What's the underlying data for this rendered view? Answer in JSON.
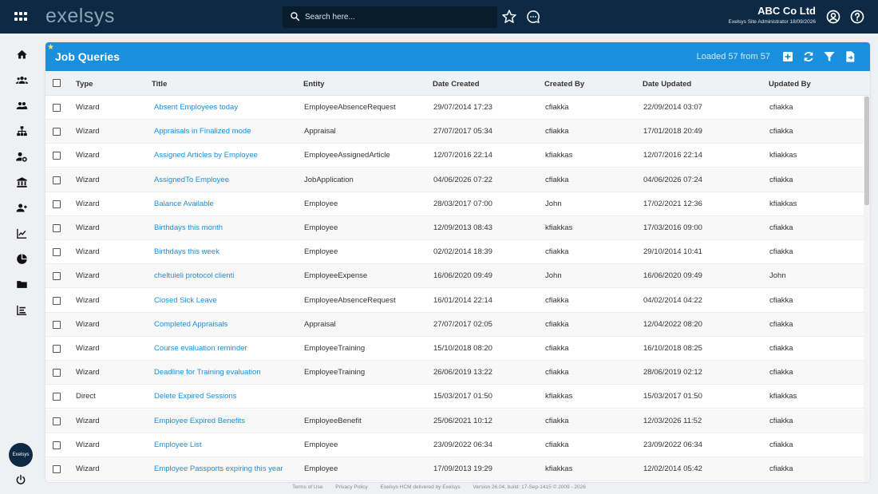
{
  "header": {
    "logo_text": "exelsys",
    "search_placeholder": "Search here...",
    "company_name": "ABC Co Ltd",
    "user_role": "Exelsys Site Administrator 18/09/2026"
  },
  "sidebar": {
    "items": [
      "home-icon",
      "employees-icon",
      "groups-icon",
      "org-chart-icon",
      "user-settings-icon",
      "bank-icon",
      "add-user-icon",
      "trend-chart-icon",
      "pie-chart-icon",
      "folder-icon",
      "list-icon"
    ],
    "avatar_text": "Exelsys"
  },
  "panel": {
    "title": "Job Queries",
    "loaded_text": "Loaded 57 from 57",
    "accent_color": "#1a8fdc"
  },
  "table": {
    "columns": [
      "Type",
      "Title",
      "Entity",
      "Date Created",
      "Created By",
      "Date Updated",
      "Updated By"
    ],
    "rows": [
      [
        "Wizard",
        "Absent Employees today",
        "EmployeeAbsenceRequest",
        "29/07/2014 17:23",
        "cfiakka",
        "22/09/2014 03:07",
        "cfiakka"
      ],
      [
        "Wizard",
        "Appraisals in Finalized mode",
        "Appraisal",
        "27/07/2017 05:34",
        "cfiakka",
        "17/01/2018 20:49",
        "cfiakka"
      ],
      [
        "Wizard",
        "Assigned Articles by Employee",
        "EmployeeAssignedArticle",
        "12/07/2016 22:14",
        "kfiakkas",
        "12/07/2016 22:14",
        "kfiakkas"
      ],
      [
        "Wizard",
        "AssignedTo Employee",
        "JobApplication",
        "04/06/2026 07:22",
        "cfiakka",
        "04/06/2026 07:24",
        "cfiakka"
      ],
      [
        "Wizard",
        "Balance Available",
        "Employee",
        "28/03/2017 07:00",
        "John",
        "17/02/2021 12:36",
        "kfiakkas"
      ],
      [
        "Wizard",
        "Birthdays this month",
        "Employee",
        "12/09/2013 08:43",
        "kfiakkas",
        "17/03/2016 09:00",
        "cfiakka"
      ],
      [
        "Wizard",
        "Birthdays this week",
        "Employee",
        "02/02/2014 18:39",
        "cfiakka",
        "29/10/2014 10:41",
        "cfiakka"
      ],
      [
        "Wizard",
        "cheltuieli protocol clienti",
        "EmployeeExpense",
        "16/06/2020 09:49",
        "John",
        "16/06/2020 09:49",
        "John"
      ],
      [
        "Wizard",
        "Closed Sick Leave",
        "EmployeeAbsenceRequest",
        "16/01/2014 22:14",
        "cfiakka",
        "04/02/2014 04:22",
        "cfiakka"
      ],
      [
        "Wizard",
        "Completed Appraisals",
        "Appraisal",
        "27/07/2017 02:05",
        "cfiakka",
        "12/04/2022 08:20",
        "cfiakka"
      ],
      [
        "Wizard",
        "Course evaluation reminder",
        "EmployeeTraining",
        "15/10/2018 08:20",
        "cfiakka",
        "16/10/2018 08:25",
        "cfiakka"
      ],
      [
        "Wizard",
        "Deadline for Training evaluation",
        "EmployeeTraining",
        "26/06/2019 13:22",
        "cfiakka",
        "28/06/2019 02:12",
        "cfiakka"
      ],
      [
        "Direct",
        "Delete Expired Sessions",
        "",
        "15/03/2017 01:50",
        "kfiakkas",
        "15/03/2017 01:50",
        "kfiakkas"
      ],
      [
        "Wizard",
        "Employee Expired Benefits",
        "EmployeeBenefit",
        "25/06/2021 10:12",
        "cfiakka",
        "12/03/2026 11:52",
        "cfiakka"
      ],
      [
        "Wizard",
        "Employee List",
        "Employee",
        "23/09/2022 06:34",
        "cfiakka",
        "23/09/2022 06:34",
        "cfiakka"
      ],
      [
        "Wizard",
        "Employee Passports expiring this year",
        "Employee",
        "17/09/2013 19:29",
        "kfiakkas",
        "12/02/2014 05:42",
        "cfiakka"
      ]
    ]
  },
  "footer": {
    "terms": "Terms of Use",
    "privacy": "Privacy Policy",
    "delivered": "Exelsys HCM delivered by Exelsys",
    "version": "Version 26.04, build: 17-Sep-1415 © 2009 - 2026"
  }
}
